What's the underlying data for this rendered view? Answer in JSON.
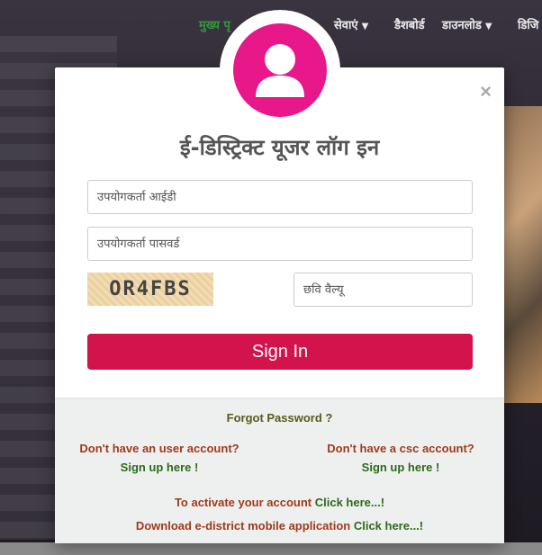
{
  "nav": {
    "items": [
      {
        "label": "मुख्य पृ",
        "active": true
      },
      {
        "label": "सेवाएं",
        "caret": true
      },
      {
        "label": "डैशबोर्ड"
      },
      {
        "label": "डाउनलोड",
        "caret": true
      },
      {
        "label": "डिजि"
      }
    ]
  },
  "modal": {
    "close_glyph": "×",
    "title": "ई-डिस्ट्रिक्ट यूजर लॉग इन",
    "username_placeholder": "उपयोगकर्ता आईडी",
    "password_placeholder": "उपयोगकर्ता पासवर्ड",
    "captcha_text": "OR4FBS",
    "captcha_placeholder": "छवि वैल्यू",
    "signin_label": "Sign In",
    "avatar_icon": "user-icon",
    "colors": {
      "avatar": "#e8178a",
      "signin": "#d3134c",
      "link": "#2b6b1a",
      "question": "#a03a1a"
    }
  },
  "footer": {
    "forgot": "Forgot Password ?",
    "user_question": "Don't have an user account?",
    "user_link": "Sign up here !",
    "csc_question": "Don't have a csc account?",
    "csc_link": "Sign up here !",
    "activate_text": "To activate your account",
    "activate_link": "Click here...!",
    "download_text": "Download e-district mobile application",
    "download_link": "Click here...!"
  }
}
